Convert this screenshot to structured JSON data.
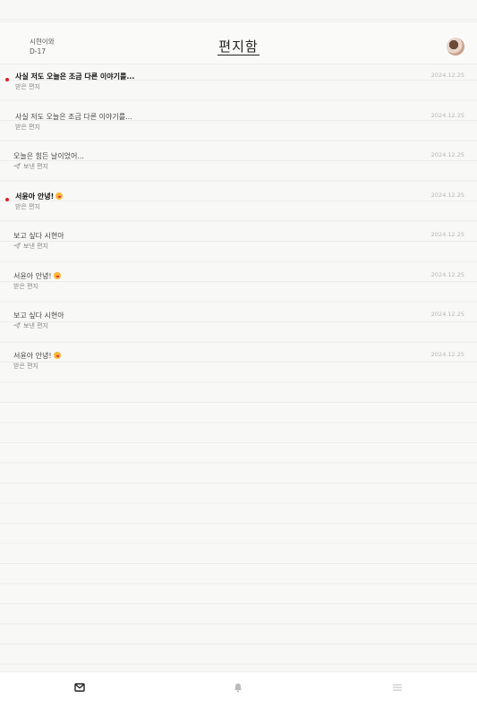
{
  "header": {
    "partner_name": "시현이와",
    "dday": "D-17",
    "title": "편지함"
  },
  "letters": [
    {
      "subject": "사실 저도 오늘은 조금 다른 이야기를...",
      "kind": "받은 편지",
      "date": "2024.12.25",
      "unread": true,
      "sent": false,
      "emoji": false
    },
    {
      "subject": "사실 저도 오늘은 조금 다른 이야기를...",
      "kind": "받은 편지",
      "date": "2024.12.25",
      "unread": false,
      "sent": false,
      "emoji": false
    },
    {
      "subject": "오늘은 힘든 날이었어...",
      "kind": "보낸 편지",
      "date": "2024.12.25",
      "unread": false,
      "sent": true,
      "emoji": false
    },
    {
      "subject": "서윤아 안녕!",
      "kind": "받은 편지",
      "date": "2024.12.25",
      "unread": true,
      "sent": false,
      "emoji": true
    },
    {
      "subject": "보고 싶다 시현아",
      "kind": "보낸 편지",
      "date": "2024.12.25",
      "unread": false,
      "sent": true,
      "emoji": false
    },
    {
      "subject": "서윤아 안녕!",
      "kind": "받은 편지",
      "date": "2024.12.25",
      "unread": false,
      "sent": false,
      "emoji": true
    },
    {
      "subject": "보고 싶다 시현아",
      "kind": "보낸 편지",
      "date": "2024.12.25",
      "unread": false,
      "sent": true,
      "emoji": false
    },
    {
      "subject": "서윤아 안녕!",
      "kind": "받은 편지",
      "date": "2024.12.25",
      "unread": false,
      "sent": false,
      "emoji": true
    }
  ],
  "icons": {
    "unread_dot_color": "#e0202a",
    "emoji": "winking-face-with-tongue-icon",
    "sent": "paper-plane-icon"
  },
  "tabs": [
    {
      "name": "mailbox",
      "icon": "envelope-icon",
      "active": true
    },
    {
      "name": "notifications",
      "icon": "bell-icon",
      "active": false
    },
    {
      "name": "menu",
      "icon": "hamburger-menu-icon",
      "active": false
    }
  ]
}
